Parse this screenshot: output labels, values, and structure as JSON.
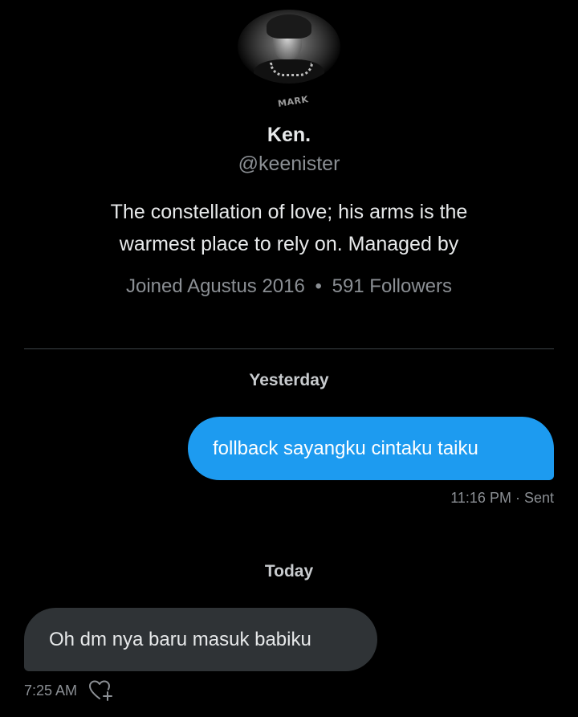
{
  "profile": {
    "avatar_watermark": "MARK",
    "name": "Ken.",
    "handle": "@keenister",
    "bio": "The constellation of love; his arms is the warmest place to rely on. Managed by",
    "joined": "Joined Agustus 2016",
    "separator": "•",
    "followers": "591 Followers"
  },
  "conversation": {
    "groups": [
      {
        "day": "Yesterday",
        "message": {
          "direction": "sent",
          "text": "follback sayangku cintaku taiku",
          "time": "11:16 PM",
          "status": "Sent"
        }
      },
      {
        "day": "Today",
        "message": {
          "direction": "received",
          "text": "Oh dm nya baru masuk babiku",
          "time": "7:25 AM",
          "reaction_icon": "heart-add-icon"
        }
      }
    ]
  },
  "colors": {
    "background": "#000000",
    "sent_bubble": "#1d9bf0",
    "received_bubble": "#2f3336",
    "secondary_text": "#8b8f94",
    "primary_text": "#e7e9ea"
  }
}
